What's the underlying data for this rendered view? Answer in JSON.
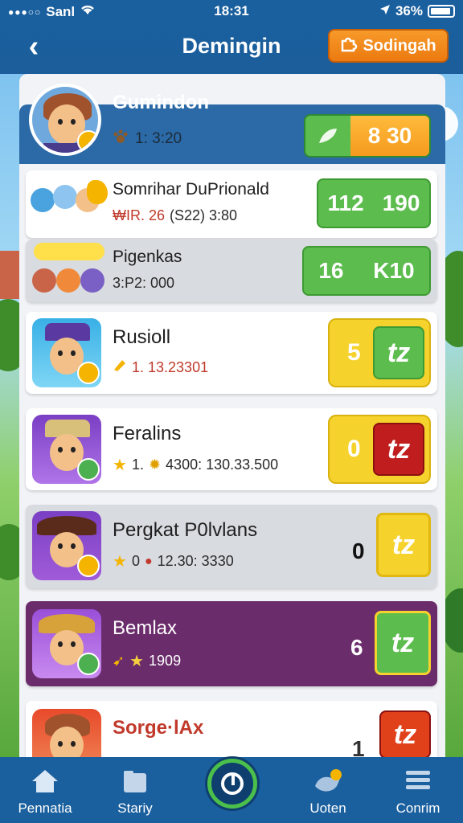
{
  "status_bar": {
    "carrier": "Sanl",
    "time": "18:31",
    "battery": "36%"
  },
  "header": {
    "back_glyph": "‹",
    "title": "Demingin",
    "action_label": "Sodingah",
    "action_icon": "puzzle-icon"
  },
  "profile": {
    "name": "Gumindon",
    "stat": "1: 3:20",
    "score": "8 30"
  },
  "rows": [
    {
      "title": "Somrihar DuPrionald",
      "sub_a": "₩IR. 26",
      "sub_b": "(S22) 3:80",
      "score_a": "112",
      "score_b": "190"
    },
    {
      "title": "Pigenkas",
      "sub_a": "3:P2: 000",
      "score_a": "16",
      "score_b": "K10"
    },
    {
      "title": "Rusioll",
      "sub_a": "1. 13.23301",
      "num": "5",
      "tag": "tz"
    },
    {
      "title": "Feralins",
      "sub_a": "1.",
      "sub_b": "4300: 130.33.500",
      "num": "0",
      "tag": "tz"
    },
    {
      "title": "Pergkat P0lvlans",
      "sub_a": "0",
      "sub_b": "12.30: 3330",
      "num": "0",
      "tag": "tz"
    },
    {
      "title": "Bemlax",
      "sub_a": "1909",
      "num": "6",
      "tag": "tz"
    },
    {
      "title": "Sorge·lAx",
      "num": "1",
      "tag": "tz"
    }
  ],
  "nav": [
    {
      "label": "Pennatia",
      "icon": "home-icon"
    },
    {
      "label": "Stariy",
      "icon": "folder-icon"
    },
    {
      "label": "",
      "icon": "center-play-icon"
    },
    {
      "label": "Uoten",
      "icon": "bird-icon"
    },
    {
      "label": "Conrim",
      "icon": "menu-icon"
    }
  ],
  "colors": {
    "header_blue": "#1a5f9e",
    "accent_orange": "#ec7a10",
    "score_green": "#5cbc4e",
    "tag_red": "#c01e1e",
    "tag_yellow": "#f6d22c",
    "purple_row": "#6b2c6b"
  }
}
